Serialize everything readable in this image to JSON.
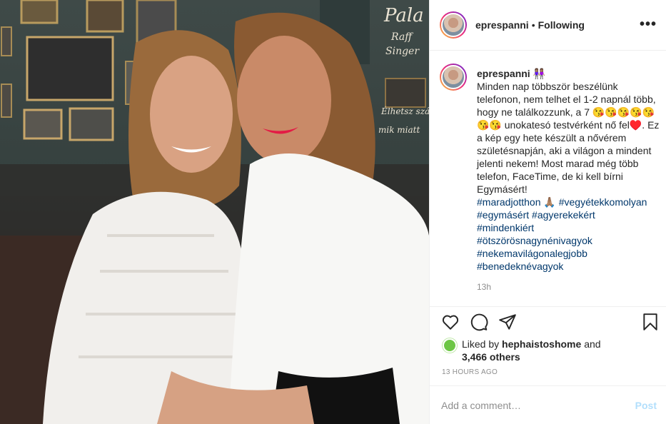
{
  "post": {
    "author": "eprespanni",
    "follow_status": "Following",
    "separator": "•",
    "more_label": "•••",
    "caption_emoji_after_name": "👭🏽",
    "caption_text": "Minden nap többször beszélünk telefonon, nem telhet el 1-2 napnál több, hogy ne találkozzunk, a 7 😘😘😘😘😘😘😘 unokatesó testvérként nő fel♥️. Ez a kép egy hete készült a nővérem születésnapján, aki a világon a mindent jelenti nekem! Most marad még több telefon, FaceTime, de ki kell bírni Egymásért!",
    "hashtags": [
      "#maradjotthon 🙏🏽",
      "#vegyétekkomolyan",
      "#egymásért",
      "#agyerekekért",
      "#mindenkiért",
      "#ötszörösnagynénivagyok",
      "#nekemavilágonalegjobb",
      "#benedeknévagyok"
    ],
    "caption_time": "13h",
    "liked_by_prefix": "Liked by",
    "liked_by_user": "hephaistoshome",
    "liked_by_and": "and",
    "others": "3,466 others",
    "posted_ago": "13 HOURS AGO",
    "comment_placeholder": "Add a comment…",
    "post_button": "Post"
  },
  "icons": {
    "like": "heart-icon",
    "comment": "comment-bubble-icon",
    "share": "paper-plane-icon",
    "save": "bookmark-icon"
  },
  "colors": {
    "hashtag": "#00376b",
    "muted": "#8e8e8e",
    "post_button_disabled": "#b2dffc",
    "border": "#efefef"
  }
}
